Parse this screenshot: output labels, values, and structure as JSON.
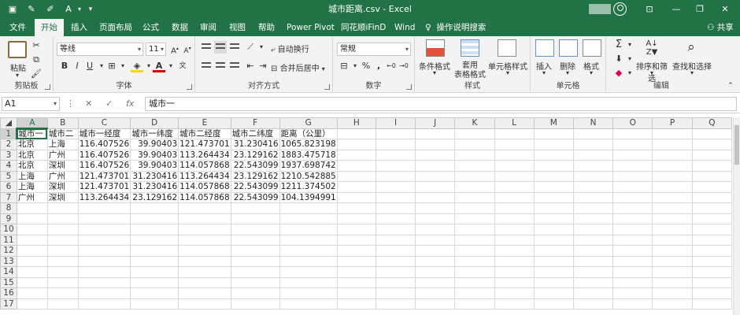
{
  "app": {
    "title": "城市距离.csv - Excel"
  },
  "window_controls": {
    "minimize": "—",
    "restore": "❐",
    "close": "✕",
    "ribbon_options": "⊡"
  },
  "tabs": [
    "文件",
    "开始",
    "插入",
    "页面布局",
    "公式",
    "数据",
    "审阅",
    "视图",
    "帮助",
    "Power Pivot",
    "同花顺iFinD",
    "Wind"
  ],
  "active_tab": "开始",
  "tell_me": "操作说明搜索",
  "share": "共享",
  "ribbon": {
    "clipboard": {
      "label": "剪贴板",
      "paste": "粘贴"
    },
    "font": {
      "label": "字体",
      "name": "等线",
      "size": "11",
      "bold": "B",
      "italic": "I",
      "underline": "U"
    },
    "alignment": {
      "label": "对齐方式",
      "wrap": "自动换行",
      "merge": "合并后居中"
    },
    "number": {
      "label": "数字",
      "format": "常规"
    },
    "styles": {
      "label": "样式",
      "conditional": "条件格式",
      "table_format_1": "套用",
      "table_format_2": "表格格式",
      "cell_styles": "单元格样式"
    },
    "cells": {
      "label": "单元格",
      "insert": "插入",
      "delete": "删除",
      "format": "格式"
    },
    "editing": {
      "label": "编辑",
      "sort_filter": "排序和筛选",
      "find_select": "查找和选择"
    }
  },
  "formula_bar": {
    "name_box": "A1",
    "value": "城市一"
  },
  "sheet": {
    "columns": [
      "A",
      "B",
      "C",
      "D",
      "E",
      "F",
      "G",
      "H",
      "I",
      "J",
      "K",
      "L",
      "M",
      "N",
      "O",
      "P",
      "Q"
    ],
    "selected_cell": "A1",
    "rows": [
      [
        "城市一",
        "城市二",
        "城市一经度",
        "城市一纬度",
        "城市二经度",
        "城市二纬度",
        "距离（公里）"
      ],
      [
        "北京",
        "上海",
        "116.407526",
        "39.90403",
        "121.473701",
        "31.230416",
        "1065.823198"
      ],
      [
        "北京",
        "广州",
        "116.407526",
        "39.90403",
        "113.264434",
        "23.129162",
        "1883.475718"
      ],
      [
        "北京",
        "深圳",
        "116.407526",
        "39.90403",
        "114.057868",
        "22.543099",
        "1937.698742"
      ],
      [
        "上海",
        "广州",
        "121.473701",
        "31.230416",
        "113.264434",
        "23.129162",
        "1210.542885"
      ],
      [
        "上海",
        "深圳",
        "121.473701",
        "31.230416",
        "114.057868",
        "22.543099",
        "1211.374502"
      ],
      [
        "广州",
        "深圳",
        "113.264434",
        "23.129162",
        "114.057868",
        "22.543099",
        "104.1394991"
      ]
    ],
    "row_numbers": [
      "1",
      "2",
      "3",
      "4",
      "5",
      "6",
      "7",
      "8",
      "9",
      "10",
      "11",
      "12",
      "13",
      "14",
      "15",
      "16",
      "17"
    ]
  },
  "colors": {
    "brand": "#217346",
    "ribbon_bg": "#f3f3f3"
  }
}
